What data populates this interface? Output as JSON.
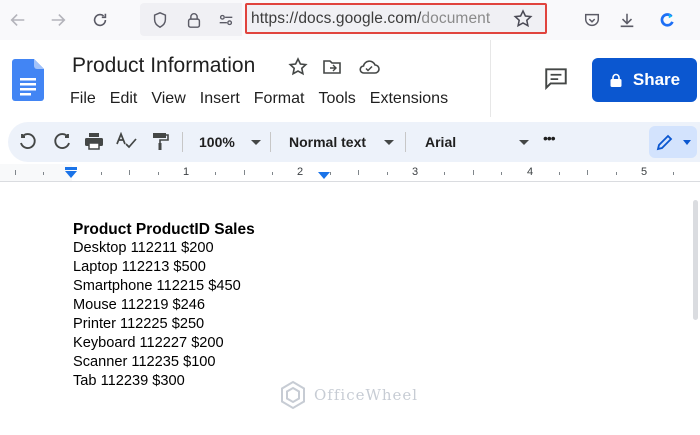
{
  "browser": {
    "url_main": "https://docs.google.com/",
    "url_rest": "document",
    "icons": [
      "back-arrow-icon",
      "forward-arrow-icon",
      "reload-icon",
      "shield-icon",
      "lock-icon",
      "permissions-icon",
      "bookmark-star-icon",
      "pocket-icon",
      "download-icon",
      "firefox-sync-icon"
    ]
  },
  "docs": {
    "title": "Product Information",
    "menu": [
      "File",
      "Edit",
      "View",
      "Insert",
      "Format",
      "Tools",
      "Extensions"
    ],
    "share_label": "Share"
  },
  "toolbar": {
    "zoom": "100%",
    "style": "Normal text",
    "font": "Arial",
    "more": "•••"
  },
  "ruler": {
    "numbers": [
      "1",
      "2",
      "3",
      "4",
      "5"
    ]
  },
  "document": {
    "lines": [
      "Product ProductID Sales",
      "Desktop 112211 $200",
      "Laptop 112213 $500",
      "Smartphone 112215 $450",
      "Mouse 112219 $246",
      "Printer 112225 $250",
      "Keyboard 112227 $200",
      "Scanner 112235 $100",
      "Tab 112239 $300"
    ]
  },
  "watermark": {
    "text": "OfficeWheel"
  },
  "colors": {
    "accent": "#0b57d0",
    "url_highlight": "#e0433d"
  }
}
